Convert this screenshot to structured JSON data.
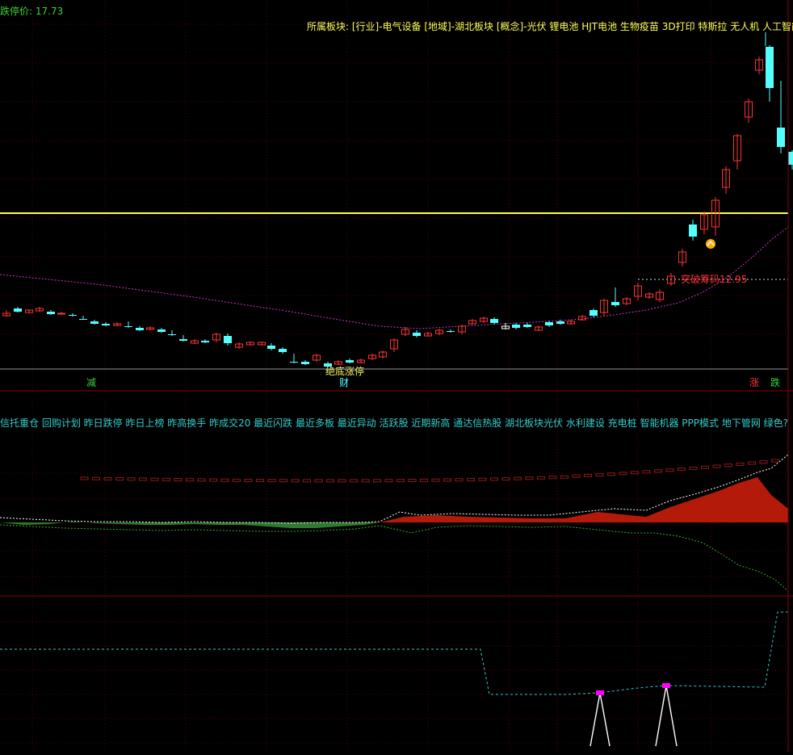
{
  "header": {
    "limit_label": "跌停价: 17.73",
    "sector_line": "所属板块: [行业]-电气设备 [地域]-湖北板块 [概念]-光伏 锂电池 HJT电池 生物疫苗 3D打印 特斯拉 无人机 人工智能 口"
  },
  "annotations": {
    "breakout": "突破筹码12.95",
    "bottom_text": "绝底涨停"
  },
  "flags": {
    "left": "减",
    "center": "财",
    "right_up": "涨",
    "right_down": "跌"
  },
  "concept_line": "信托重仓 回购计划 昨日跌停 昨日上榜 昨高换手 昨成交20 最近闪跌 最近多板 最近异动 活跃股 近期新高 通达信热股 湖北板块光伏 水利建设 充电桩 智能机器 PPP模式 地下管网 绿色?",
  "colors": {
    "up": "#ff3333",
    "down": "#54ffff",
    "yellow_line": "#ffff55",
    "ma_line": "#cc33cc",
    "grid": "#8b0000",
    "area_fill": "#b31a0a",
    "green_fill": "#2f7a2f"
  }
}
